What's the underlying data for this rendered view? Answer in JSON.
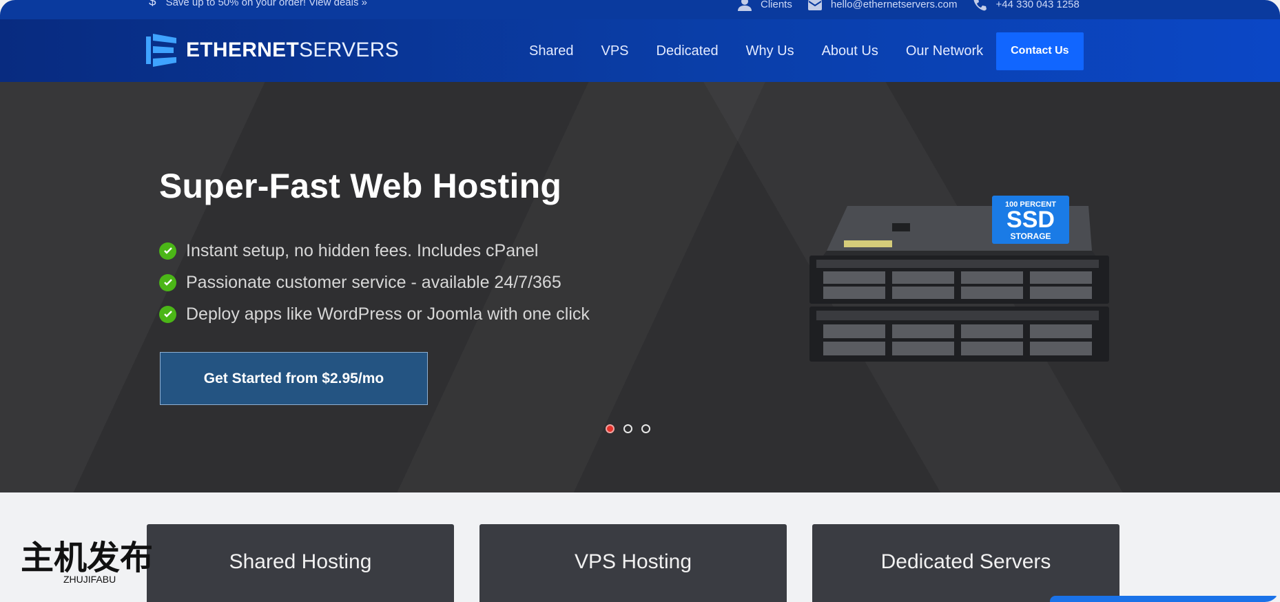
{
  "topbar": {
    "deal": "Save up to 50% on your order! View deals »",
    "clients": "Clients",
    "email": "hello@ethernetservers.com",
    "phone": "+44 330 043 1258"
  },
  "logo": {
    "bold": "ETHERNET",
    "light": "SERVERS"
  },
  "nav": {
    "items": [
      {
        "label": "Shared"
      },
      {
        "label": "VPS"
      },
      {
        "label": "Dedicated"
      },
      {
        "label": "Why Us"
      },
      {
        "label": "About Us"
      },
      {
        "label": "Our Network"
      }
    ],
    "contact": "Contact Us"
  },
  "hero": {
    "title": "Super-Fast Web Hosting",
    "features": [
      "Instant setup, no hidden fees. Includes cPanel",
      "Passionate customer service - available 24/7/365",
      "Deploy apps like WordPress or Joomla with one click"
    ],
    "cta": "Get Started from $2.95/mo",
    "badge": {
      "line1": "100 PERCENT",
      "line2": "SSD",
      "line3": "STORAGE"
    },
    "slides": {
      "count": 3,
      "active": 1
    }
  },
  "cards": [
    {
      "label": "Shared Hosting"
    },
    {
      "label": "VPS Hosting"
    },
    {
      "label": "Dedicated Servers"
    }
  ],
  "watermark": {
    "cn": "主机发布",
    "latin": "ZHUJIFABU"
  },
  "colors": {
    "brand_blue": "#0b47c6",
    "contact_blue": "#1166ff",
    "check_green": "#4bb617",
    "cta_blue": "#245482",
    "active_dot": "#e5322b"
  },
  "icons": {
    "deal": "dollar-icon",
    "clients": "user-icon",
    "email": "mail-icon",
    "phone": "phone-icon",
    "check": "check-circle-icon"
  }
}
